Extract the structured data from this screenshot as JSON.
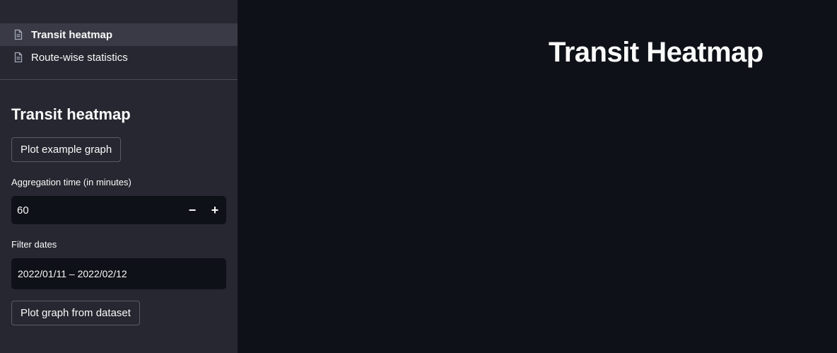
{
  "nav": {
    "items": [
      {
        "label": "Transit heatmap",
        "icon": "document-icon",
        "active": true
      },
      {
        "label": "Route-wise statistics",
        "icon": "document-icon",
        "active": false
      }
    ]
  },
  "sidebar": {
    "title": "Transit heatmap",
    "plot_example_label": "Plot example graph",
    "aggregation_label": "Aggregation time (in minutes)",
    "aggregation_value": "60",
    "decrement_symbol": "−",
    "increment_symbol": "+",
    "filter_label": "Filter dates",
    "date_range": "2022/01/11 – 2022/02/12",
    "plot_dataset_label": "Plot graph from dataset"
  },
  "main": {
    "title": "Transit Heatmap"
  },
  "colors": {
    "background": "#0e1117",
    "sidebar": "#262730",
    "active_item": "#393a45",
    "text": "#fafafa"
  }
}
